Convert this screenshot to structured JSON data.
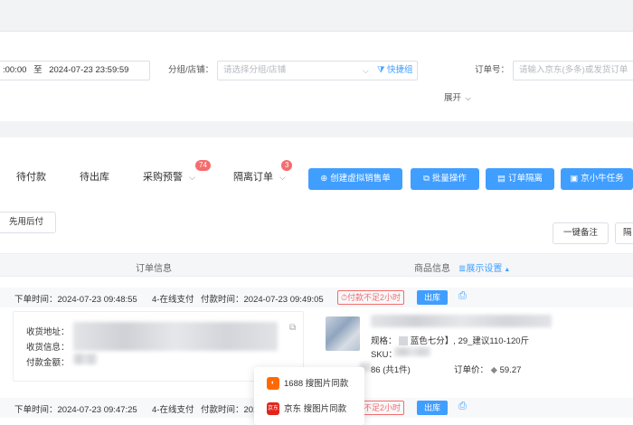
{
  "filters": {
    "date_start_fragment": ":00:00",
    "date_sep": "至",
    "date_end": "2024-07-23 23:59:59",
    "group_label": "分组/店铺：",
    "group_placeholder": "请选择分组/店铺",
    "quick_group": "快捷组",
    "order_no_label": "订单号：",
    "order_no_placeholder": "请输入京东(多条)或发货订单",
    "expand_label": "展开"
  },
  "tabs": [
    {
      "label": "待付款"
    },
    {
      "label": "待出库"
    },
    {
      "label": "采购预警",
      "badge": "74"
    },
    {
      "label": "隔离订单",
      "badge": "3"
    }
  ],
  "toolbar": {
    "create_virtual": "创建虚拟销售单",
    "batch": "批量操作",
    "isolate": "订单隔离",
    "jd_task": "京小牛任务",
    "pay_first": "先用后付",
    "one_note": "一键备注",
    "partial_next": "隔"
  },
  "table": {
    "col_order_info": "订单信息",
    "col_goods_info": "商品信息",
    "display_settings": "展示设置"
  },
  "orders": [
    {
      "order_time": "下单时间：2024-07-23 09:48:55",
      "pay_type": "4-在线支付",
      "pay_time": "付款时间：2024-07-23 09:49:05",
      "warning": "付款不足2小时",
      "action": "出库",
      "addr_label": "收货地址：",
      "receiver_label": "收货信息：",
      "amount_label": "付款金额：",
      "spec": "规格：",
      "spec_value": "蓝色七分】, 29_建议110-120斤",
      "sku_label": "SKU：",
      "qty": "86 (共1件)",
      "price_label": "订单价：",
      "price_value": "59.27"
    },
    {
      "order_time": "下单时间：2024-07-23 09:47:25",
      "pay_type": "4-在线支付",
      "pay_time": "付款时间：2024-07-23 09:47:33",
      "warning": "付款不足2小时",
      "action": "出库"
    }
  ],
  "popup": {
    "item1": "1688 搜图片同款",
    "item2": "京东 搜图片同款",
    "item2_logo": "京东"
  },
  "colors": {
    "primary": "#409eff",
    "danger": "#f56c6c"
  }
}
